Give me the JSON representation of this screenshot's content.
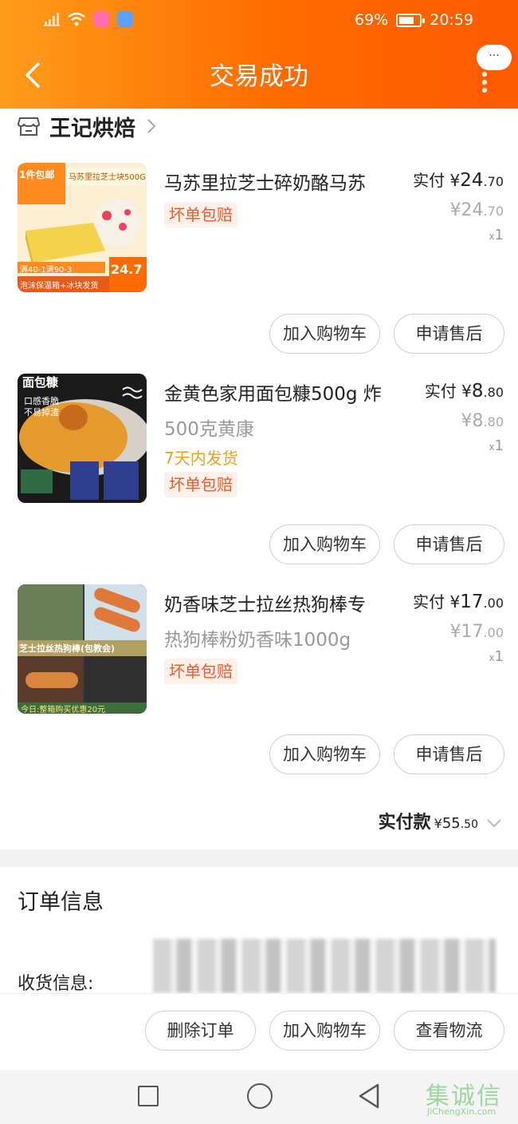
{
  "status_bar": {
    "battery_percent": "69%",
    "time": "20:59"
  },
  "header": {
    "title": "交易成功",
    "more_label": "···"
  },
  "store": {
    "name": "王记烘焙"
  },
  "items": [
    {
      "name": "马苏里拉芝士碎奶酪马苏",
      "sku": "",
      "ship_note": "",
      "badge": "坏单包赔",
      "paid_label": "实付",
      "currency": "¥",
      "paid_int": "24",
      "paid_dec": ".70",
      "orig_int": "24",
      "orig_dec": ".70",
      "qty_x": "x",
      "qty": "1",
      "thumb_text": {
        "tag": "1件包邮",
        "title": "马苏里拉芝士块500G",
        "promo": "满40-1满90-3",
        "price": "24.7",
        "note": "泡沫保温箱+冰块发货"
      },
      "buttons": {
        "add_cart": "加入购物车",
        "after_sale": "申请售后"
      }
    },
    {
      "name": "金黄色家用面包糠500g 炸",
      "sku": "500克黄康",
      "ship_note": "7天内发货",
      "badge": "坏单包赔",
      "paid_label": "实付",
      "currency": "¥",
      "paid_int": "8",
      "paid_dec": ".80",
      "orig_int": "8",
      "orig_dec": ".80",
      "qty_x": "x",
      "qty": "1",
      "thumb_text": {
        "tag": "面包糠",
        "line1": "口感香脆",
        "line2": "不易掉渣"
      },
      "buttons": {
        "add_cart": "加入购物车",
        "after_sale": "申请售后"
      }
    },
    {
      "name": "奶香味芝士拉丝热狗棒专",
      "sku": "热狗棒粉奶香味1000g",
      "ship_note": "",
      "badge": "坏单包赔",
      "paid_label": "实付",
      "currency": "¥",
      "paid_int": "17",
      "paid_dec": ".00",
      "orig_int": "17",
      "orig_dec": ".00",
      "qty_x": "x",
      "qty": "1",
      "thumb_text": {
        "banner": "芝士拉丝热狗棒(包教会)",
        "footer": "今日:整箱购买优惠20元"
      },
      "buttons": {
        "add_cart": "加入购物车",
        "after_sale": "申请售后"
      }
    }
  ],
  "total": {
    "label": "实付款",
    "currency": "¥",
    "int": "55",
    "dec": ".50"
  },
  "order_info": {
    "title": "订单信息",
    "shipping_label": "收货信息:"
  },
  "action_bar": {
    "delete_order": "删除订单",
    "add_cart": "加入购物车",
    "view_logistics": "查看物流"
  },
  "watermark": {
    "text": "集诚信",
    "url_text": "JiChengXin.com"
  },
  "colors": {
    "header_start": "#ff9c1a",
    "header_end": "#ff5a00",
    "badge_text": "#f05a2a",
    "ship_note": "#f0a020"
  }
}
